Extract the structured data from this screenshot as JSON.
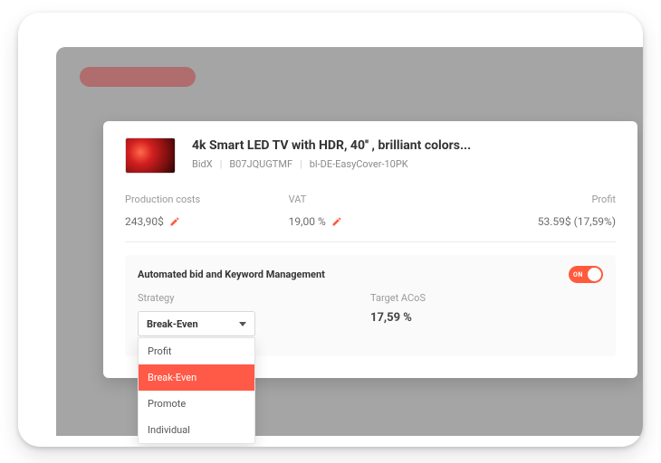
{
  "product": {
    "title": "4k Smart LED TV with HDR, 40'' , brilliant colors...",
    "brand": "BidX",
    "asin": "B07JQUGTMF",
    "sku": "bl-DE-EasyCover-10PK"
  },
  "metrics": {
    "production_costs": {
      "label": "Production costs",
      "value": "243,90$"
    },
    "vat": {
      "label": "VAT",
      "value": "19,00 %"
    },
    "profit": {
      "label": "Profit",
      "value": "53.59$ (17,59%)"
    }
  },
  "automation": {
    "section_title": "Automated bid and Keyword Management",
    "toggle_on_label": "ON",
    "strategy_label": "Strategy",
    "strategy_selected": "Break-Even",
    "strategy_options": [
      "Profit",
      "Break-Even",
      "Promote",
      "Individual"
    ],
    "target_acos_label": "Target ACoS",
    "target_acos_value": "17,59 %"
  }
}
